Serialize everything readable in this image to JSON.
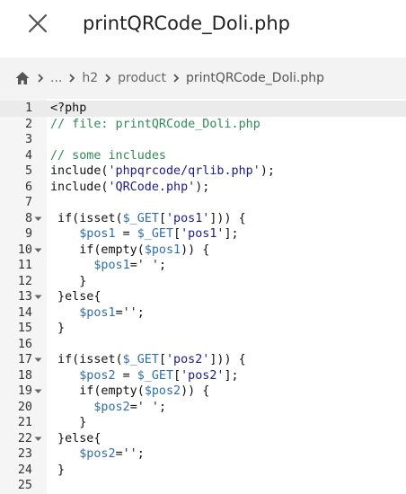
{
  "header": {
    "title": "printQRCode_Doli.php"
  },
  "breadcrumb": {
    "items": [
      "...",
      "h2",
      "product",
      "printQRCode_Doli.php"
    ]
  },
  "editor": {
    "active_line": 1,
    "fold_lines": [
      8,
      10,
      13,
      17,
      19,
      22
    ],
    "lines": [
      [
        {
          "t": "<?php",
          "c": "plain"
        }
      ],
      [
        {
          "t": "// file: printQRCode_Doli.php",
          "c": "comment"
        }
      ],
      [],
      [
        {
          "t": "// some includes",
          "c": "comment"
        }
      ],
      [
        {
          "t": "include(",
          "c": "plain"
        },
        {
          "t": "'phpqrcode/qrlib.php'",
          "c": "str"
        },
        {
          "t": ");",
          "c": "plain"
        }
      ],
      [
        {
          "t": "include(",
          "c": "plain"
        },
        {
          "t": "'QRCode.php'",
          "c": "str"
        },
        {
          "t": ");",
          "c": "plain"
        }
      ],
      [],
      [
        {
          "t": " if(isset(",
          "c": "plain"
        },
        {
          "t": "$_GET",
          "c": "var"
        },
        {
          "t": "[",
          "c": "plain"
        },
        {
          "t": "'pos1'",
          "c": "str"
        },
        {
          "t": "])) {",
          "c": "plain"
        }
      ],
      [
        {
          "t": "    ",
          "c": "plain"
        },
        {
          "t": "$pos1",
          "c": "var"
        },
        {
          "t": " = ",
          "c": "plain"
        },
        {
          "t": "$_GET",
          "c": "var"
        },
        {
          "t": "[",
          "c": "plain"
        },
        {
          "t": "'pos1'",
          "c": "str"
        },
        {
          "t": "];",
          "c": "plain"
        }
      ],
      [
        {
          "t": "    if(empty(",
          "c": "plain"
        },
        {
          "t": "$pos1",
          "c": "var"
        },
        {
          "t": ")) {",
          "c": "plain"
        }
      ],
      [
        {
          "t": "      ",
          "c": "plain"
        },
        {
          "t": "$pos1",
          "c": "var"
        },
        {
          "t": "=",
          "c": "plain"
        },
        {
          "t": "' '",
          "c": "str"
        },
        {
          "t": ";",
          "c": "plain"
        }
      ],
      [
        {
          "t": "    }",
          "c": "plain"
        }
      ],
      [
        {
          "t": " }else{",
          "c": "plain"
        }
      ],
      [
        {
          "t": "    ",
          "c": "plain"
        },
        {
          "t": "$pos1",
          "c": "var"
        },
        {
          "t": "=",
          "c": "plain"
        },
        {
          "t": "''",
          "c": "str"
        },
        {
          "t": ";",
          "c": "plain"
        }
      ],
      [
        {
          "t": " }",
          "c": "plain"
        }
      ],
      [],
      [
        {
          "t": " if(isset(",
          "c": "plain"
        },
        {
          "t": "$_GET",
          "c": "var"
        },
        {
          "t": "[",
          "c": "plain"
        },
        {
          "t": "'pos2'",
          "c": "str"
        },
        {
          "t": "])) {",
          "c": "plain"
        }
      ],
      [
        {
          "t": "    ",
          "c": "plain"
        },
        {
          "t": "$pos2",
          "c": "var"
        },
        {
          "t": " = ",
          "c": "plain"
        },
        {
          "t": "$_GET",
          "c": "var"
        },
        {
          "t": "[",
          "c": "plain"
        },
        {
          "t": "'pos2'",
          "c": "str"
        },
        {
          "t": "];",
          "c": "plain"
        }
      ],
      [
        {
          "t": "    if(empty(",
          "c": "plain"
        },
        {
          "t": "$pos2",
          "c": "var"
        },
        {
          "t": ")) {",
          "c": "plain"
        }
      ],
      [
        {
          "t": "      ",
          "c": "plain"
        },
        {
          "t": "$pos2",
          "c": "var"
        },
        {
          "t": "=",
          "c": "plain"
        },
        {
          "t": "' '",
          "c": "str"
        },
        {
          "t": ";",
          "c": "plain"
        }
      ],
      [
        {
          "t": "    }",
          "c": "plain"
        }
      ],
      [
        {
          "t": " }else{",
          "c": "plain"
        }
      ],
      [
        {
          "t": "    ",
          "c": "plain"
        },
        {
          "t": "$pos2",
          "c": "var"
        },
        {
          "t": "=",
          "c": "plain"
        },
        {
          "t": "''",
          "c": "str"
        },
        {
          "t": ";",
          "c": "plain"
        }
      ],
      [
        {
          "t": " }",
          "c": "plain"
        }
      ],
      []
    ]
  },
  "colors": {
    "comment": "#2e8b57",
    "string": "#1a1a8c",
    "variable": "#2f6fa8",
    "gutter": "#f5f5f5",
    "breadcrumb_bg": "#f3f3f3"
  },
  "icons": {
    "close": "close-icon",
    "home": "home-icon",
    "separator": "chevron-right-icon",
    "fold": "chevron-down-icon"
  }
}
